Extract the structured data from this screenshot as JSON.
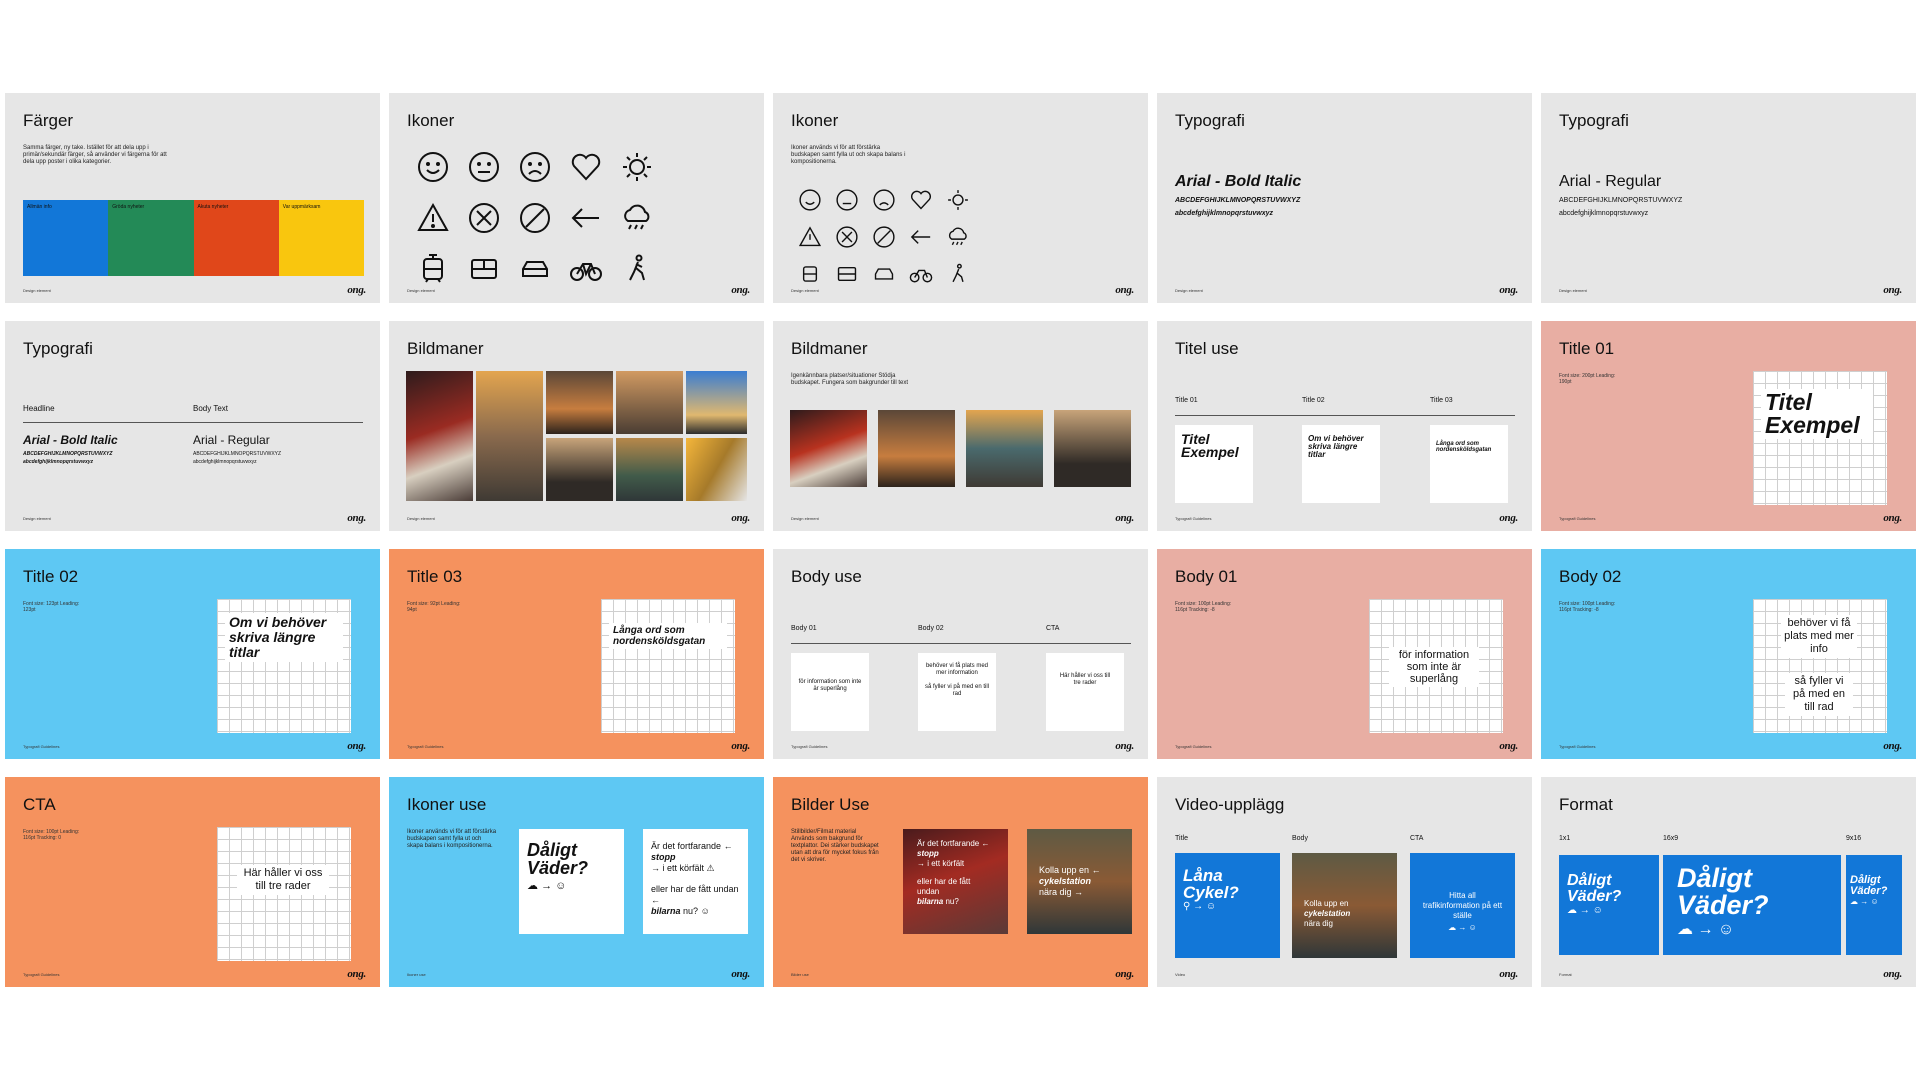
{
  "logo": "ong.",
  "slides": {
    "s1": {
      "title": "Färger",
      "desc": "Samma färger, ny take. Istället för att dela upp i primär/sekundär färger, så använder vi färgerna för att dela upp poster i olika kategorier.",
      "foot": "Design element",
      "swatches": [
        {
          "label": "Allmän info",
          "color": "#1277d8"
        },
        {
          "label": "Gröda nyheter",
          "color": "#238a57"
        },
        {
          "label": "Akuta nyheter",
          "color": "#e0471a"
        },
        {
          "label": "Var uppmärksam",
          "color": "#f9c60e"
        }
      ]
    },
    "s2": {
      "title": "Ikoner",
      "foot": "Design element"
    },
    "s3": {
      "title": "Ikoner",
      "desc": "Ikoner används vi för att förstärka budskapen samt fylla ut och skapa balans i kompositionerna.",
      "foot": "Design element"
    },
    "s4": {
      "title": "Typografi",
      "font_name": "Arial - Bold Italic",
      "upper": "ABCDEFGHIJKLMNOPQRSTUVWXYZ",
      "lower": "abcdefghijklmnopqrstuvwxyz",
      "foot": "Design element"
    },
    "s5": {
      "title": "Typografi",
      "font_name": "Arial - Regular",
      "upper": "ABCDEFGHIJKLMNOPQRSTUVWXYZ",
      "lower": "abcdefghijklmnopqrstuvwxyz",
      "foot": "Design element"
    },
    "s6": {
      "title": "Typografi",
      "headline": "Headline",
      "body_text": "Body Text",
      "font1": "Arial - Bold Italic",
      "font2": "Arial - Regular",
      "upper": "ABCDEFGHIJKLMNOPQRSTUVWXYZ",
      "lower": "abcdefghijklmnopqrstuvwxyz",
      "foot": "Design element"
    },
    "s7": {
      "title": "Bildmaner",
      "foot": "Design element"
    },
    "s8": {
      "title": "Bildmaner",
      "desc": "Igenkännbara platser/situationer Stödja budskapet. Fungera som bakgrunder till text",
      "foot": "Design element"
    },
    "s9": {
      "title": "Titel use",
      "col1": "Title 01",
      "col2": "Title 02",
      "col3": "Title 03",
      "card1": "Titel Exempel",
      "card2": "Om vi behöver skriva längre titlar",
      "card3": "Långa ord som nordensköldsgatan",
      "foot": "Typografi Guidelines"
    },
    "s10": {
      "title": "Title 01",
      "spec": "Font size: 200pt Leading: 190pt",
      "sample": "Titel Exempel",
      "foot": "Typografi Guidelines"
    },
    "s11": {
      "title": "Title 02",
      "spec": "Font size: 123pt Leading: 123pt",
      "sample": "Om vi behöver skriva längre titlar",
      "foot": "Typografi Guidelines"
    },
    "s12": {
      "title": "Title 03",
      "spec": "Font size: 92pt Leading: 94pt",
      "sample": "Långa ord som nordensköldsgatan",
      "foot": "Typografi Guidelines"
    },
    "s13": {
      "title": "Body use",
      "col1": "Body 01",
      "col2": "Body 02",
      "col3": "CTA",
      "card1": "för information som inte är superlång",
      "card2": "behöver vi få plats med mer information\n\nså fyller vi på med en till rad",
      "card3": "Här håller vi oss till tre rader",
      "foot": "Typografi Guidelines"
    },
    "s14": {
      "title": "Body 01",
      "spec": "Font size: 100pt Leading: 116pt Tracking: -8",
      "sample": "för information som inte är superlång",
      "foot": "Typografi Guidelines"
    },
    "s15": {
      "title": "Body 02",
      "spec": "Font size: 100pt Leading: 116pt Tracking: -8",
      "sample1": "behöver vi få plats med mer info",
      "sample2": "så fyller vi på med en till rad",
      "foot": "Typografi Guidelines"
    },
    "s16": {
      "title": "CTA",
      "spec": "Font size: 100pt Leading: 116pt Tracking: 0",
      "sample": "Här håller vi oss till tre rader",
      "foot": "Typografi Guidelines"
    },
    "s17": {
      "title": "Ikoner use",
      "desc": "Ikoner används vi för att förstärka budskapen samt fylla ut och skapa balans i kompositionerna.",
      "card1": "Dåligt Väder?",
      "c2l1": "Är det fortfarande",
      "c2b": "stopp",
      "c2l2": "i ett körfält",
      "c2l3": "eller har de fått undan",
      "c2b2": "bilarna",
      "c2l4": "nu?",
      "foot": "Ikoner use"
    },
    "s18": {
      "title": "Bilder Use",
      "desc": "Stillbilder/Filmat material Används som bakgrund för textplattor. Dei stärker budskapet utan att dra för mycket fokus från det vi skriver.",
      "p1l1": "Är det fortfarande",
      "p1b": "stopp",
      "p1l2": "i ett körfält",
      "p1l3": "eller har de fått undan",
      "p1b2": "bilarna",
      "p1l4": "nu?",
      "p2l1": "Kolla upp en",
      "p2b": "cykelstation",
      "p2l2": "nära dig",
      "foot": "Bilder use"
    },
    "s19": {
      "title": "Video-upplägg",
      "col1": "Title",
      "col2": "Body",
      "col3": "CTA",
      "card1": "Låna Cykel?",
      "card2a": "Kolla upp en",
      "card2b": "cykelstation",
      "card2c": "nära dig",
      "card3": "Hitta all trafikinformation på ett ställe",
      "foot": "Video"
    },
    "s20": {
      "title": "Format",
      "col1": "1x1",
      "col2": "16x9",
      "col3": "9x16",
      "card": "Dåligt Väder?",
      "foot": "Format"
    }
  }
}
